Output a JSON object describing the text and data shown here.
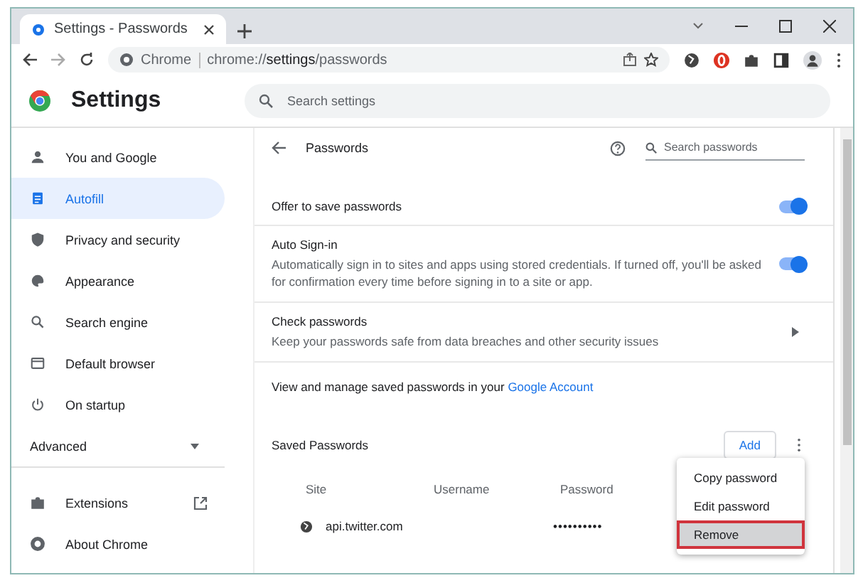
{
  "tab": {
    "title": "Settings - Passwords"
  },
  "address_bar": {
    "origin": "Chrome",
    "url": "chrome://**settings**/passwords"
  },
  "header": {
    "title": "Settings",
    "search": {
      "placeholder": "Search settings"
    }
  },
  "sidebar": {
    "items": [
      {
        "label": "You and Google",
        "selected": false
      },
      {
        "label": "Autofill",
        "selected": true
      },
      {
        "label": "Privacy and security",
        "selected": false
      },
      {
        "label": "Appearance",
        "selected": false
      },
      {
        "label": "Search engine",
        "selected": false
      },
      {
        "label": "Default browser",
        "selected": false
      },
      {
        "label": "On startup",
        "selected": false
      }
    ],
    "advanced": {
      "label": "Advanced",
      "expanded": false
    },
    "footer_items": [
      {
        "label": "Extensions"
      },
      {
        "label": "About Chrome"
      }
    ]
  },
  "page": {
    "title": "Passwords",
    "search": {
      "placeholder": "Search passwords"
    },
    "settings": [
      {
        "kind": "toggle",
        "title": "Offer to save passwords",
        "on": true
      },
      {
        "kind": "toggle",
        "title": "Auto Sign-in",
        "description": "Automatically sign in to sites and apps using stored credentials. If turned off, you'll be asked for confirmation every time before signing in to a site or app.",
        "on": true
      },
      {
        "kind": "link",
        "title": "Check passwords",
        "description": "Keep your passwords safe from data breaches and other security issues"
      }
    ],
    "account_text": "View and manage saved passwords in your",
    "account_link": "Google Account",
    "saved": {
      "title": "Saved Passwords",
      "add_button": "Add",
      "columns": [
        "Site",
        "Username",
        "Password"
      ],
      "rows": [
        {
          "site": "api.twitter.com",
          "username": "",
          "password": "••••••••••"
        }
      ]
    },
    "menu": {
      "items": [
        {
          "label": "Copy password",
          "selected": false
        },
        {
          "label": "Edit password",
          "selected": false
        },
        {
          "label": "Remove",
          "selected": true
        }
      ]
    }
  }
}
